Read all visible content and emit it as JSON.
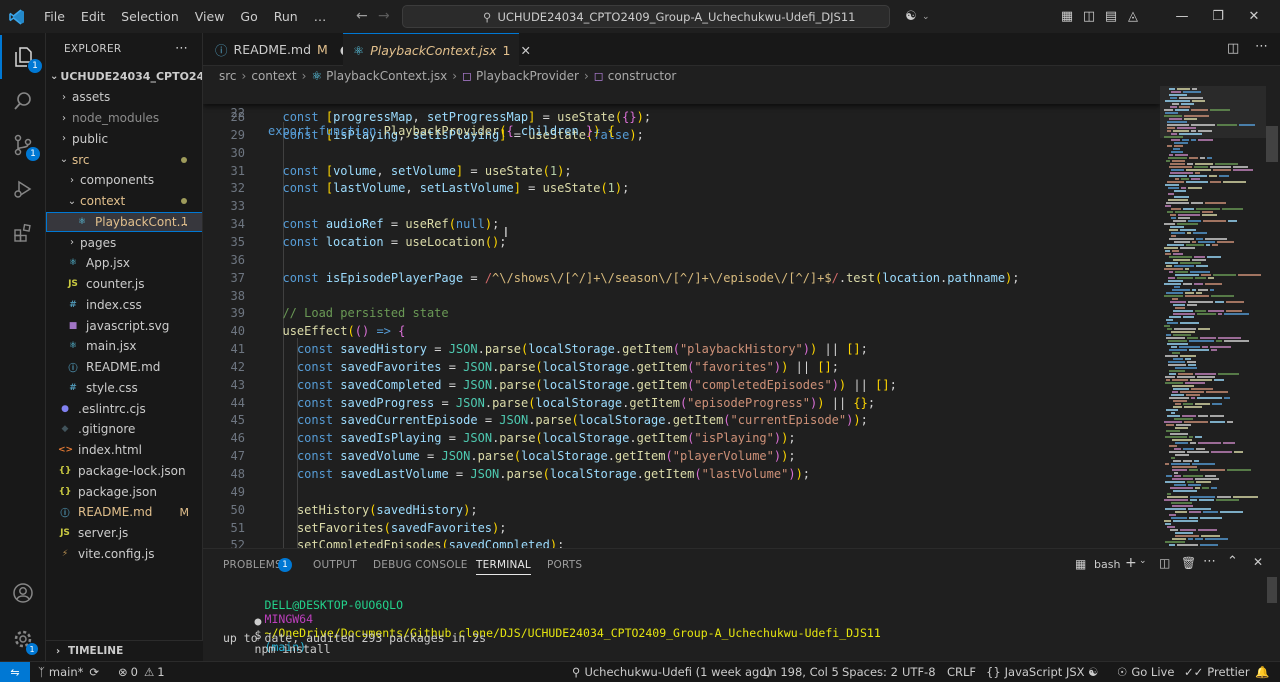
{
  "titlebar": {
    "menus": [
      "File",
      "Edit",
      "Selection",
      "View",
      "Go",
      "Run",
      "…"
    ],
    "search_text": "UCHUDE24034_CPTO2409_Group-A_Uchechukwu-Udefi_DJS11"
  },
  "activity": {
    "explorer_badge": "1",
    "source_control_badge": "1"
  },
  "sidebar": {
    "title": "EXPLORER",
    "more": "⋯",
    "root": "UCHUDE24034_CPTO2409...",
    "items": [
      {
        "label": "assets",
        "chev": "›",
        "icon": "",
        "type": "folder"
      },
      {
        "label": "node_modules",
        "chev": "›",
        "icon": "",
        "type": "folder-dim"
      },
      {
        "label": "public",
        "chev": "›",
        "icon": "",
        "type": "folder"
      },
      {
        "label": "src",
        "chev": "⌄",
        "icon": "",
        "type": "folder-mod"
      },
      {
        "label": "components",
        "chev": "›",
        "icon": "",
        "type": "folder"
      },
      {
        "label": "context",
        "chev": "⌄",
        "icon": "",
        "type": "folder-mod"
      },
      {
        "label": "PlaybackCont...",
        "chev": "",
        "icon": "⚛",
        "type": "selected",
        "count": "1"
      },
      {
        "label": "pages",
        "chev": "›",
        "icon": "",
        "type": "folder"
      },
      {
        "label": "App.jsx",
        "chev": "",
        "icon": "⚛",
        "type": "file"
      },
      {
        "label": "counter.js",
        "chev": "",
        "icon": "JS",
        "type": "file"
      },
      {
        "label": "index.css",
        "chev": "",
        "icon": "#",
        "type": "file"
      },
      {
        "label": "javascript.svg",
        "chev": "",
        "icon": "■",
        "type": "file"
      },
      {
        "label": "main.jsx",
        "chev": "",
        "icon": "⚛",
        "type": "file"
      },
      {
        "label": "README.md",
        "chev": "",
        "icon": "ⓘ",
        "type": "file"
      },
      {
        "label": "style.css",
        "chev": "",
        "icon": "#",
        "type": "file"
      },
      {
        "label": ".eslintrc.cjs",
        "chev": "",
        "icon": "●",
        "type": "file"
      },
      {
        "label": ".gitignore",
        "chev": "",
        "icon": "◆",
        "type": "file"
      },
      {
        "label": "index.html",
        "chev": "",
        "icon": "<>",
        "type": "file"
      },
      {
        "label": "package-lock.json",
        "chev": "",
        "icon": "{}",
        "type": "file"
      },
      {
        "label": "package.json",
        "chev": "",
        "icon": "{}",
        "type": "file"
      },
      {
        "label": "README.md",
        "chev": "",
        "icon": "ⓘ",
        "type": "file",
        "git": "M"
      },
      {
        "label": "server.js",
        "chev": "",
        "icon": "JS",
        "type": "file"
      },
      {
        "label": "vite.config.js",
        "chev": "",
        "icon": "⚡",
        "type": "file"
      }
    ],
    "timeline": "TIMELINE"
  },
  "tabs": [
    {
      "label": "README.md",
      "marker": "M",
      "state": "●"
    },
    {
      "label": "PlaybackContext.jsx",
      "marker": "1",
      "state": "✕"
    }
  ],
  "breadcrumb": [
    "src",
    "context",
    "PlaybackContext.jsx",
    "PlaybackProvider",
    "constructor"
  ],
  "editor": {
    "sticky": {
      "num": "22",
      "text": "export function PlaybackProvider({ children }) {"
    },
    "lines": [
      {
        "num": "28",
        "text": "  const [progressMap, setProgressMap] = useState({});"
      },
      {
        "num": "29",
        "text": "  const [isPlaying, setIsPlaying] = useState(false);"
      },
      {
        "num": "30",
        "text": ""
      },
      {
        "num": "31",
        "text": "  const [volume, setVolume] = useState(1);"
      },
      {
        "num": "32",
        "text": "  const [lastVolume, setLastVolume] = useState(1);"
      },
      {
        "num": "33",
        "text": ""
      },
      {
        "num": "34",
        "text": "  const audioRef = useRef(null);"
      },
      {
        "num": "35",
        "text": "  const location = useLocation();"
      },
      {
        "num": "36",
        "text": ""
      },
      {
        "num": "37",
        "text": "  const isEpisodePlayerPage = /^\\/shows\\/[^/]+\\/season\\/[^/]+\\/episode\\/[^/]+$/.test(location.pathname);"
      },
      {
        "num": "38",
        "text": ""
      },
      {
        "num": "39",
        "text": "  // Load persisted state"
      },
      {
        "num": "40",
        "text": "  useEffect(() => {"
      },
      {
        "num": "41",
        "text": "    const savedHistory = JSON.parse(localStorage.getItem(\"playbackHistory\")) || [];"
      },
      {
        "num": "42",
        "text": "    const savedFavorites = JSON.parse(localStorage.getItem(\"favorites\")) || [];"
      },
      {
        "num": "43",
        "text": "    const savedCompleted = JSON.parse(localStorage.getItem(\"completedEpisodes\")) || [];"
      },
      {
        "num": "44",
        "text": "    const savedProgress = JSON.parse(localStorage.getItem(\"episodeProgress\")) || {};"
      },
      {
        "num": "45",
        "text": "    const savedCurrentEpisode = JSON.parse(localStorage.getItem(\"currentEpisode\"));"
      },
      {
        "num": "46",
        "text": "    const savedIsPlaying = JSON.parse(localStorage.getItem(\"isPlaying\"));"
      },
      {
        "num": "47",
        "text": "    const savedVolume = JSON.parse(localStorage.getItem(\"playerVolume\"));"
      },
      {
        "num": "48",
        "text": "    const savedLastVolume = JSON.parse(localStorage.getItem(\"lastVolume\"));"
      },
      {
        "num": "49",
        "text": ""
      },
      {
        "num": "50",
        "text": "    setHistory(savedHistory);"
      },
      {
        "num": "51",
        "text": "    setFavorites(savedFavorites);"
      },
      {
        "num": "52",
        "text": "    setCompletedEpisodes(savedCompleted);"
      }
    ]
  },
  "panel": {
    "tabs": [
      "PROBLEMS",
      "OUTPUT",
      "DEBUG CONSOLE",
      "TERMINAL",
      "PORTS"
    ],
    "problems_badge": "1",
    "shell": "bash",
    "terminal": {
      "user_host": "DELL@DESKTOP-0UO6QLO",
      "env": "MINGW64",
      "path": "~/OneDrive/Documents/Github clone/DJS/UCHUDE24034_CPTO2409_Group-A_Uchechukwu-Udefi_DJS11",
      "branch": "(main)",
      "prompt": "$",
      "command": "npm install",
      "output": "up to date, audited 293 packages in 2s"
    }
  },
  "statusbar": {
    "branch": "main*",
    "errors": "0",
    "warnings": "1",
    "blame": "Uchechukwu-Udefi (1 week ago)",
    "position": "Ln 198, Col 5",
    "spaces": "Spaces: 2",
    "encoding": "UTF-8",
    "eol": "CRLF",
    "language": "JavaScript JSX",
    "golive": "Go Live",
    "prettier": "Prettier"
  }
}
